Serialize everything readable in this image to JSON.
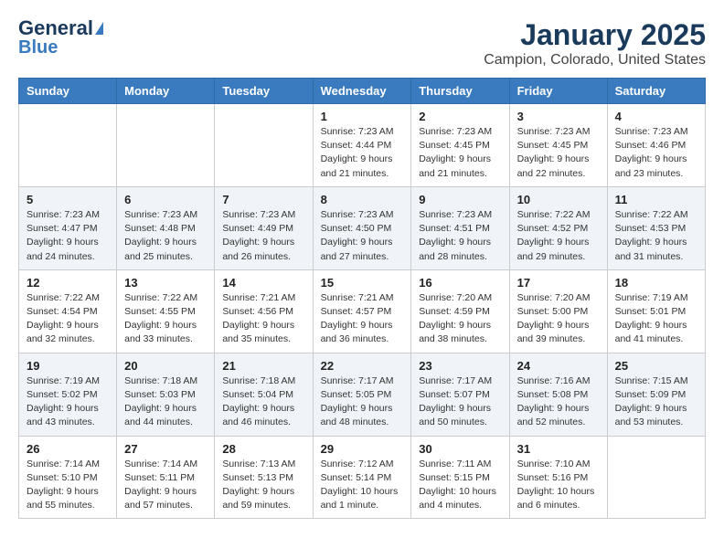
{
  "header": {
    "logo_line1": "General",
    "logo_line2": "Blue",
    "title": "January 2025",
    "subtitle": "Campion, Colorado, United States"
  },
  "weekdays": [
    "Sunday",
    "Monday",
    "Tuesday",
    "Wednesday",
    "Thursday",
    "Friday",
    "Saturday"
  ],
  "weeks": [
    [
      {
        "day": "",
        "info": ""
      },
      {
        "day": "",
        "info": ""
      },
      {
        "day": "",
        "info": ""
      },
      {
        "day": "1",
        "info": "Sunrise: 7:23 AM\nSunset: 4:44 PM\nDaylight: 9 hours\nand 21 minutes."
      },
      {
        "day": "2",
        "info": "Sunrise: 7:23 AM\nSunset: 4:45 PM\nDaylight: 9 hours\nand 21 minutes."
      },
      {
        "day": "3",
        "info": "Sunrise: 7:23 AM\nSunset: 4:45 PM\nDaylight: 9 hours\nand 22 minutes."
      },
      {
        "day": "4",
        "info": "Sunrise: 7:23 AM\nSunset: 4:46 PM\nDaylight: 9 hours\nand 23 minutes."
      }
    ],
    [
      {
        "day": "5",
        "info": "Sunrise: 7:23 AM\nSunset: 4:47 PM\nDaylight: 9 hours\nand 24 minutes."
      },
      {
        "day": "6",
        "info": "Sunrise: 7:23 AM\nSunset: 4:48 PM\nDaylight: 9 hours\nand 25 minutes."
      },
      {
        "day": "7",
        "info": "Sunrise: 7:23 AM\nSunset: 4:49 PM\nDaylight: 9 hours\nand 26 minutes."
      },
      {
        "day": "8",
        "info": "Sunrise: 7:23 AM\nSunset: 4:50 PM\nDaylight: 9 hours\nand 27 minutes."
      },
      {
        "day": "9",
        "info": "Sunrise: 7:23 AM\nSunset: 4:51 PM\nDaylight: 9 hours\nand 28 minutes."
      },
      {
        "day": "10",
        "info": "Sunrise: 7:22 AM\nSunset: 4:52 PM\nDaylight: 9 hours\nand 29 minutes."
      },
      {
        "day": "11",
        "info": "Sunrise: 7:22 AM\nSunset: 4:53 PM\nDaylight: 9 hours\nand 31 minutes."
      }
    ],
    [
      {
        "day": "12",
        "info": "Sunrise: 7:22 AM\nSunset: 4:54 PM\nDaylight: 9 hours\nand 32 minutes."
      },
      {
        "day": "13",
        "info": "Sunrise: 7:22 AM\nSunset: 4:55 PM\nDaylight: 9 hours\nand 33 minutes."
      },
      {
        "day": "14",
        "info": "Sunrise: 7:21 AM\nSunset: 4:56 PM\nDaylight: 9 hours\nand 35 minutes."
      },
      {
        "day": "15",
        "info": "Sunrise: 7:21 AM\nSunset: 4:57 PM\nDaylight: 9 hours\nand 36 minutes."
      },
      {
        "day": "16",
        "info": "Sunrise: 7:20 AM\nSunset: 4:59 PM\nDaylight: 9 hours\nand 38 minutes."
      },
      {
        "day": "17",
        "info": "Sunrise: 7:20 AM\nSunset: 5:00 PM\nDaylight: 9 hours\nand 39 minutes."
      },
      {
        "day": "18",
        "info": "Sunrise: 7:19 AM\nSunset: 5:01 PM\nDaylight: 9 hours\nand 41 minutes."
      }
    ],
    [
      {
        "day": "19",
        "info": "Sunrise: 7:19 AM\nSunset: 5:02 PM\nDaylight: 9 hours\nand 43 minutes."
      },
      {
        "day": "20",
        "info": "Sunrise: 7:18 AM\nSunset: 5:03 PM\nDaylight: 9 hours\nand 44 minutes."
      },
      {
        "day": "21",
        "info": "Sunrise: 7:18 AM\nSunset: 5:04 PM\nDaylight: 9 hours\nand 46 minutes."
      },
      {
        "day": "22",
        "info": "Sunrise: 7:17 AM\nSunset: 5:05 PM\nDaylight: 9 hours\nand 48 minutes."
      },
      {
        "day": "23",
        "info": "Sunrise: 7:17 AM\nSunset: 5:07 PM\nDaylight: 9 hours\nand 50 minutes."
      },
      {
        "day": "24",
        "info": "Sunrise: 7:16 AM\nSunset: 5:08 PM\nDaylight: 9 hours\nand 52 minutes."
      },
      {
        "day": "25",
        "info": "Sunrise: 7:15 AM\nSunset: 5:09 PM\nDaylight: 9 hours\nand 53 minutes."
      }
    ],
    [
      {
        "day": "26",
        "info": "Sunrise: 7:14 AM\nSunset: 5:10 PM\nDaylight: 9 hours\nand 55 minutes."
      },
      {
        "day": "27",
        "info": "Sunrise: 7:14 AM\nSunset: 5:11 PM\nDaylight: 9 hours\nand 57 minutes."
      },
      {
        "day": "28",
        "info": "Sunrise: 7:13 AM\nSunset: 5:13 PM\nDaylight: 9 hours\nand 59 minutes."
      },
      {
        "day": "29",
        "info": "Sunrise: 7:12 AM\nSunset: 5:14 PM\nDaylight: 10 hours\nand 1 minute."
      },
      {
        "day": "30",
        "info": "Sunrise: 7:11 AM\nSunset: 5:15 PM\nDaylight: 10 hours\nand 4 minutes."
      },
      {
        "day": "31",
        "info": "Sunrise: 7:10 AM\nSunset: 5:16 PM\nDaylight: 10 hours\nand 6 minutes."
      },
      {
        "day": "",
        "info": ""
      }
    ]
  ]
}
